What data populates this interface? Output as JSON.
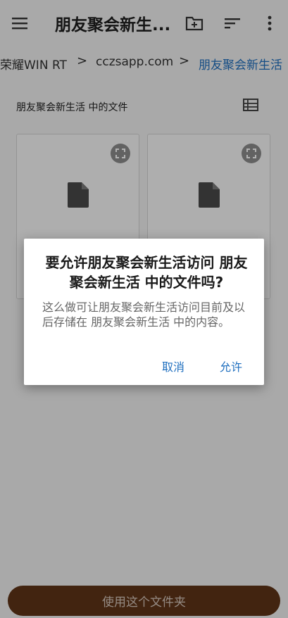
{
  "app_bar": {
    "title": "朋友聚会新生...",
    "icons": [
      "menu-icon",
      "new-folder-icon",
      "sort-icon",
      "more-vert-icon"
    ]
  },
  "breadcrumb": {
    "items": [
      "荣耀WIN RT",
      "cczsapp.com",
      "朋友聚会新生活"
    ],
    "separator": ">"
  },
  "section": {
    "title": "朋友聚会新生活 中的文件"
  },
  "dialog": {
    "title": "要允许朋友聚会新生活访问 朋友聚会新生活 中的文件吗?",
    "message": "这么做可让朋友聚会新生活访问目前及以后存储在 朋友聚会新生活 中的内容。",
    "cancel_label": "取消",
    "allow_label": "允许"
  },
  "footer": {
    "use_folder_label": "使用这个文件夹"
  },
  "colors": {
    "accent": "#1f6fbf",
    "primary_button": "#5f3417"
  }
}
